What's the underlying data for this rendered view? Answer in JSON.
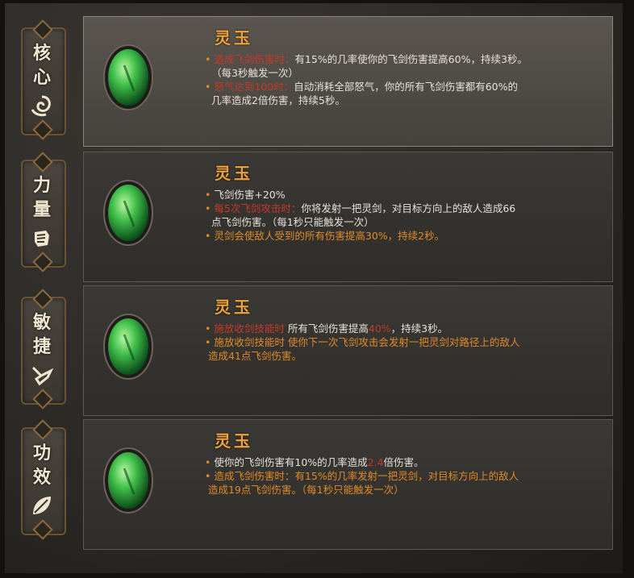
{
  "tabs": [
    {
      "chars": [
        "核",
        "心"
      ],
      "icon": "swirl-icon"
    },
    {
      "chars": [
        "力",
        "量"
      ],
      "icon": "fist-icon"
    },
    {
      "chars": [
        "敏",
        "捷"
      ],
      "icon": "boot-icon"
    },
    {
      "chars": [
        "功",
        "效"
      ],
      "icon": "leaf-icon"
    }
  ],
  "panels": [
    {
      "title": "灵玉",
      "active": true,
      "l1_trigger": "造成飞剑伤害时：",
      "l1_text": "有15%的几率使你的飞剑伤害提高60%，持续3秒。",
      "l1_cont": "（每3秒触发一次）",
      "l2_trigger": "怒气达到100时：",
      "l2_text": "自动消耗全部怒气，你的所有飞剑伤害都有60%的",
      "l2_cont": "几率造成2倍伤害，持续5秒。"
    },
    {
      "title": "灵玉",
      "l1_text": "飞剑伤害+20%",
      "l2_trigger": "每5次飞剑攻击时：",
      "l2_text": "你将发射一把灵剑，对目标方向上的敌人造成66",
      "l2_cont": "点飞剑伤害。（每1秒只能触发一次）",
      "l3_text": "灵剑会使敌人受到的所有伤害提高30%，持续2秒。"
    },
    {
      "title": "灵玉",
      "l1_trigger": "施放收剑技能时",
      "l1_text_a": "所有飞剑伤害提高",
      "l1_value": "40%",
      "l1_text_b": "，持续3秒。",
      "l2_text": "施放收剑技能时 使你下一次飞剑攻击会发射一把灵剑对路径上的敌人",
      "l2_cont": "造成41点飞剑伤害。"
    },
    {
      "title": "灵玉",
      "l1_text_a": "使你的飞剑伤害有10%的几率造成",
      "l1_value": "2.4",
      "l1_text_b": "倍伤害。",
      "l2_text": "造成飞剑伤害时：有15%的几率发射一把灵剑，对目标方向上的敌人",
      "l2_cont": "造成19点飞剑伤害。（每1秒只能触发一次）"
    }
  ],
  "colors": {
    "title": "#f0a33a",
    "trigger_red": "#c43a2a",
    "orange": "#e08a2a",
    "gem": "#3fbf4a"
  }
}
